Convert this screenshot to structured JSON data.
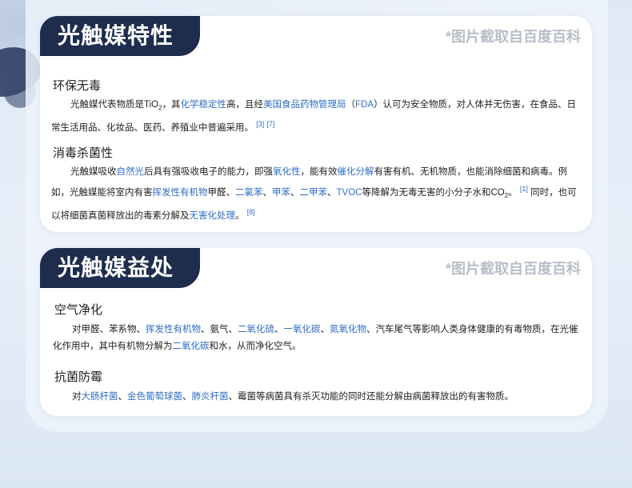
{
  "source_note": "*图片截取自百度百科",
  "section1": {
    "title": "光触媒特性",
    "blocks": [
      {
        "heading": "环保无毒",
        "p": {
          "t1": "光触媒代表物质是TiO",
          "sub": "2",
          "t2": "，其",
          "l1": "化学稳定性",
          "t3": "高，且经",
          "l2": "美国食品药物管理局",
          "t4": "（",
          "l3": "FDA",
          "t5": "）认可为安全物质，对人体并无伤害，在食品、日常生活用品、化妆品、医药、养殖业中普遍采用。",
          "c1": "[3]",
          "c2": "[7]"
        }
      },
      {
        "heading": "消毒杀菌性",
        "p": {
          "t1": "光触媒吸收",
          "l1": "自然光",
          "t2": "后具有强吸收电子的能力，即强",
          "l2": "氧化性",
          "t3": "，能有效",
          "l3": "催化分解",
          "t4": "有害有机、无机物质，也能消除细菌和病毒。例如，光触媒能将室内有害",
          "l4": "挥发性有机物",
          "t5": "甲醛、",
          "l5": "二氯苯",
          "t6": "、",
          "l6": "甲苯",
          "t7": "、",
          "l7": "二甲苯",
          "t8": "、",
          "l8": "TVOC",
          "t9": "等降解为无毒无害的小分子水和CO",
          "sub": "2",
          "t10": "。",
          "c1": "[1]",
          "t11": " 同时，也可以将细菌真菌释放出的毒素分解及",
          "l9": "无害化处理",
          "t12": "。",
          "c2": "[8]"
        }
      }
    ]
  },
  "section2": {
    "title": "光触媒益处",
    "blocks": [
      {
        "heading": "空气净化",
        "p": {
          "t1": "对甲醛、苯系物、",
          "l1": "挥发性有机物",
          "t2": "、氨气、",
          "l2": "二氧化硫",
          "t3": "、",
          "l3": "一氧化碳",
          "t4": "、",
          "l4": "氮氧化物",
          "t5": "、汽车尾气等影响人类身体健康的有毒物质，在光催化作用中，其中有机物分解为",
          "l5": "二氧化碳",
          "t6": "和水，从而净化空气。"
        }
      },
      {
        "heading": "抗菌防霉",
        "p": {
          "t1": "对",
          "l1": "大肠杆菌",
          "t2": "、",
          "l2": "金色葡萄球菌",
          "t3": "、",
          "l3": "肺炎杆菌",
          "t4": "、霉菌等病菌具有杀灭功能的同时还能分解由病菌释放出的有害物质。"
        }
      }
    ]
  }
}
